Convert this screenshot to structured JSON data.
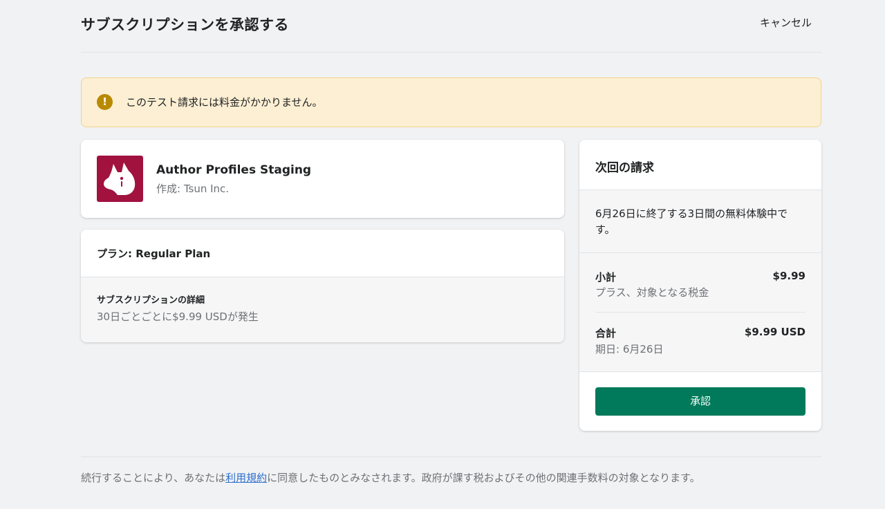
{
  "header": {
    "title": "サブスクリプションを承認する",
    "cancel_label": "キャンセル"
  },
  "banner": {
    "icon": "warning-icon",
    "icon_glyph": "!",
    "text": "このテスト請求には料金がかかりません。"
  },
  "app": {
    "name": "Author Profiles Staging",
    "author": "作成: Tsun Inc.",
    "logo": "dog-head-logo"
  },
  "plan": {
    "title": "プラン: Regular Plan",
    "details_label": "サブスクリプションの詳細",
    "details_text": "30日ごとごとに$9.99 USDが発生"
  },
  "billing": {
    "title": "次回の請求",
    "trial_text": "6月26日に終了する3日間の無料体験中です。",
    "subtotal_label": "小計",
    "subtotal_sub": "プラス、対象となる税金",
    "subtotal_value": "$9.99",
    "total_label": "合計",
    "total_sub": "期日: 6月26日",
    "total_value": "$9.99 USD",
    "approve_label": "承認"
  },
  "footer": {
    "text_before": "続行することにより、あなたは",
    "link_text": "利用規約",
    "text_after": "に同意したものとみなされます。政府が課す税およびその他の関連手数料の対象となります。"
  },
  "colors": {
    "accent": "#007a5a",
    "banner_bg": "#fcefd3",
    "warning_icon": "#b98900",
    "logo_bg": "#a1123f",
    "link": "#2c6ecb"
  }
}
